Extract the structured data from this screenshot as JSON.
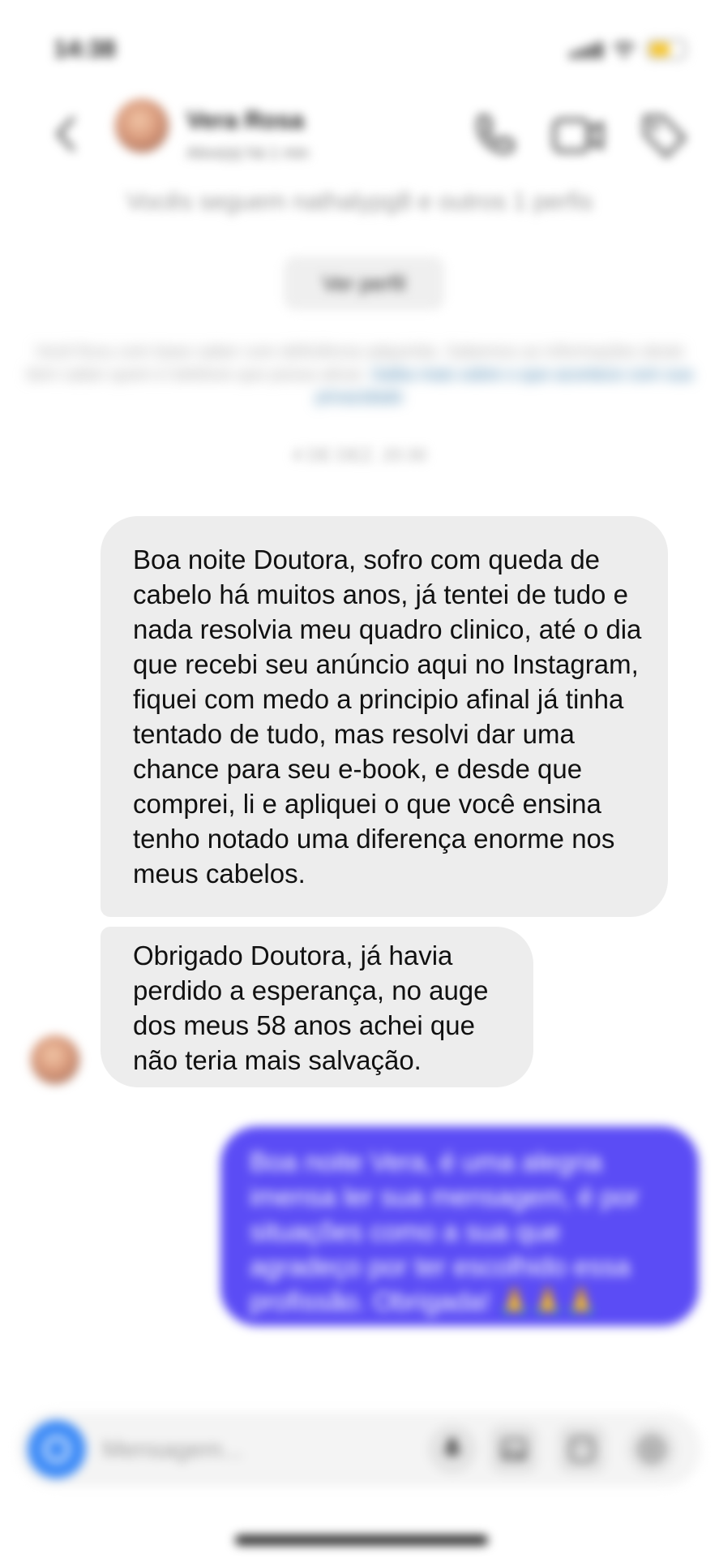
{
  "status_bar": {
    "time": "14:38"
  },
  "header": {
    "contact_name": "Vera Rosa",
    "contact_subtitle": "Ativo(a) há 1 min",
    "icons": [
      "back-icon",
      "phone-icon",
      "video-icon",
      "tag-icon"
    ]
  },
  "intro": {
    "follow_text": "Vocês seguem nathalypg8 e outros 1 perfis",
    "profile_button": "Ver perfil",
    "info_text": "Você ficou com base saber com deficiência adquirida. Sabemos as informações deste item saber quem é telefone que possa ativar.",
    "info_link": "Saiba mais sobre o que acontece com sua privacidade",
    "timestamp": "4 DE DEZ. 20:30"
  },
  "messages": {
    "received_1": "Boa noite Doutora, sofro com queda de cabelo há muitos anos, já tentei de tudo e nada resolvia meu quadro clinico, até o dia que recebi seu anúncio aqui no Instagram, fiquei com medo a principio afinal já tinha tentado de tudo, mas resolvi dar uma chance para seu e-book, e desde que comprei, li e apliquei o que você ensina tenho notado uma diferença enorme nos meus cabelos.",
    "received_2": "Obrigado Doutora, já havia perdido a esperança, no auge dos meus 58 anos achei que não teria mais salvação.",
    "sent_1": "Boa noite Vera, é uma alegria imensa ler sua mensagem, é por situações como a sua que agradeço por ter escolhido essa profissão. Obrigada! 🙏🙏🙏"
  },
  "composer": {
    "placeholder": "Mensagem...",
    "icons": [
      "camera-icon",
      "microphone-icon",
      "gallery-icon",
      "sticker-icon",
      "plus-icon"
    ]
  },
  "colors": {
    "sent_bubble": "#5b4cf5",
    "received_bubble": "#ededed",
    "camera_button": "#3f8cf7",
    "battery": "#f7c425"
  }
}
